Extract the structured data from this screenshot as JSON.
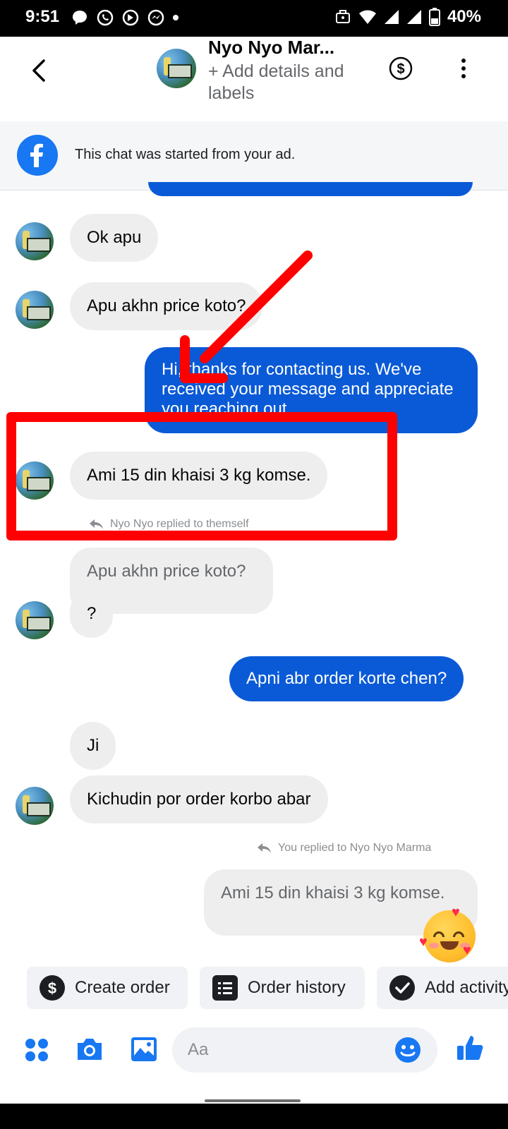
{
  "status_bar": {
    "time": "9:51",
    "battery": "40%"
  },
  "header": {
    "name": "Nyo Nyo Mar...",
    "subtitle": "+ Add details and labels"
  },
  "ad_banner": {
    "text": "This chat was started from your ad."
  },
  "messages": [
    {
      "dir": "in",
      "text": "Ok apu"
    },
    {
      "dir": "in",
      "text": "Apu akhn price koto?"
    },
    {
      "dir": "out",
      "text": "Hi, thanks for contacting us. We've received your message and appreciate you reaching out."
    },
    {
      "dir": "in",
      "text": "Ami 15 din khaisi 3 kg komse."
    },
    {
      "dir": "in",
      "quoted": "Apu akhn price koto?",
      "text": "?"
    },
    {
      "dir": "out",
      "text": "Apni abr order korte chen?"
    },
    {
      "dir": "in",
      "text": "Ji"
    },
    {
      "dir": "in",
      "text": "Kichudin por order korbo abar"
    },
    {
      "dir": "out",
      "quoted": "Ami 15 din khaisi 3 kg komse."
    }
  ],
  "reply_labels": {
    "them": "Nyo Nyo replied to themself",
    "you": "You replied to Nyo Nyo Marma"
  },
  "actions": [
    "Create order",
    "Order history",
    "Add activity"
  ],
  "composer": {
    "placeholder": "Aa"
  },
  "annotations": {
    "arrow_color": "#ff0000",
    "box_color": "#ff0000"
  },
  "colors": {
    "outgoing": "#0a5ad7",
    "incoming": "#eeeeee",
    "accent": "#1877f2"
  },
  "icons": [
    "back-icon",
    "dollar-icon",
    "more-icon",
    "facebook-icon",
    "reply-icon",
    "grid-icon",
    "camera-icon",
    "gallery-icon",
    "emoji-icon",
    "like-icon"
  ]
}
